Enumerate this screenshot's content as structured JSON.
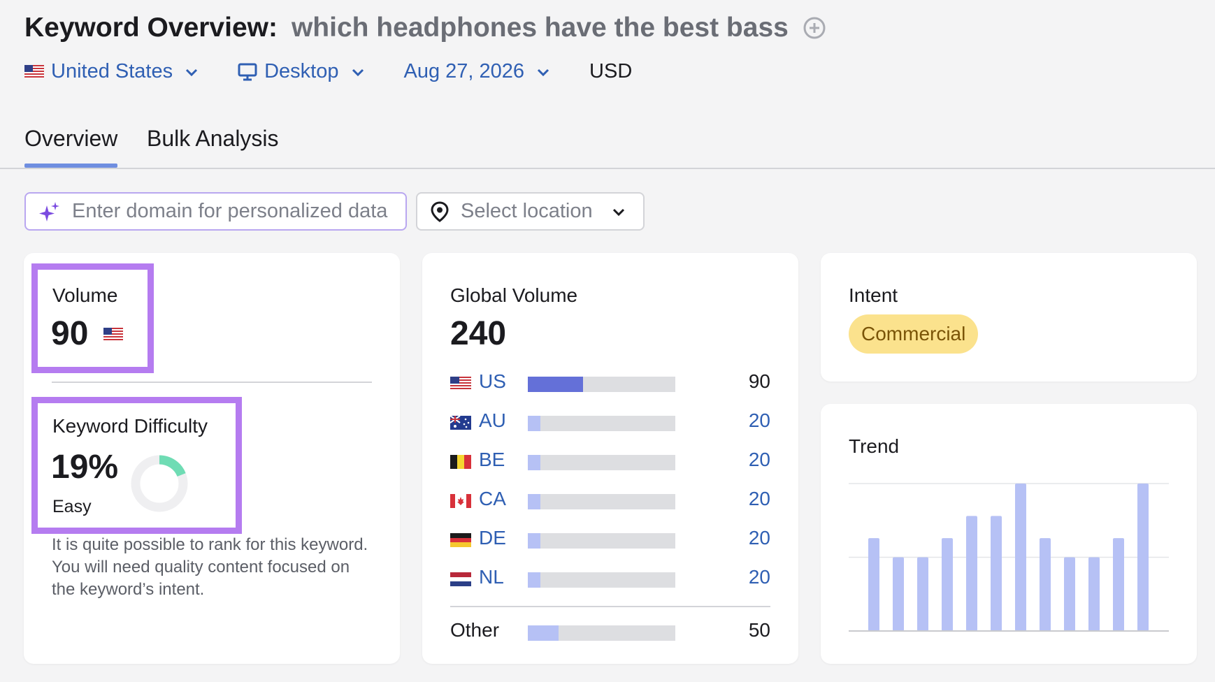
{
  "header": {
    "title": "Keyword Overview:",
    "keyword": "which headphones have the best bass",
    "add_icon": "plus-circle-icon"
  },
  "filters": {
    "country": "United States",
    "device": "Desktop",
    "date": "Aug 27, 2026",
    "currency": "USD"
  },
  "tabs": [
    {
      "label": "Overview",
      "active": true
    },
    {
      "label": "Bulk Analysis",
      "active": false
    }
  ],
  "domain_input": {
    "placeholder": "Enter domain for personalized data",
    "value": "",
    "icon": "sparkle-icon"
  },
  "location_select": {
    "placeholder": "Select location",
    "icon": "location-pin-icon"
  },
  "volume": {
    "label": "Volume",
    "value": "90",
    "flag": "us-flag"
  },
  "keyword_difficulty": {
    "label": "Keyword Difficulty",
    "value": "19%",
    "percent": 19,
    "level": "Easy",
    "description": "It is quite possible to rank for this keyword. You will need quality content focused on the keyword’s intent."
  },
  "global_volume": {
    "label": "Global Volume",
    "value": "240",
    "rows": [
      {
        "code": "US",
        "value": "90",
        "share": 0.375,
        "link": false
      },
      {
        "code": "AU",
        "value": "20",
        "share": 0.083,
        "link": true
      },
      {
        "code": "BE",
        "value": "20",
        "share": 0.083,
        "link": true
      },
      {
        "code": "CA",
        "value": "20",
        "share": 0.083,
        "link": true
      },
      {
        "code": "DE",
        "value": "20",
        "share": 0.083,
        "link": true
      },
      {
        "code": "NL",
        "value": "20",
        "share": 0.083,
        "link": true
      }
    ],
    "other": {
      "label": "Other",
      "value": "50",
      "share": 0.208
    }
  },
  "intent": {
    "label": "Intent",
    "badge": "Commercial"
  },
  "trend": {
    "label": "Trend",
    "values": [
      0.63,
      0.5,
      0.5,
      0.63,
      0.78,
      0.78,
      1.0,
      0.63,
      0.5,
      0.5,
      0.63,
      1.0
    ]
  },
  "colors": {
    "accent_bar_us": "#6470d8",
    "bar_light": "#b6c1f5",
    "highlight": "#b57cf0",
    "kd_green": "#6fdcb4",
    "link": "#2f5fb3"
  }
}
